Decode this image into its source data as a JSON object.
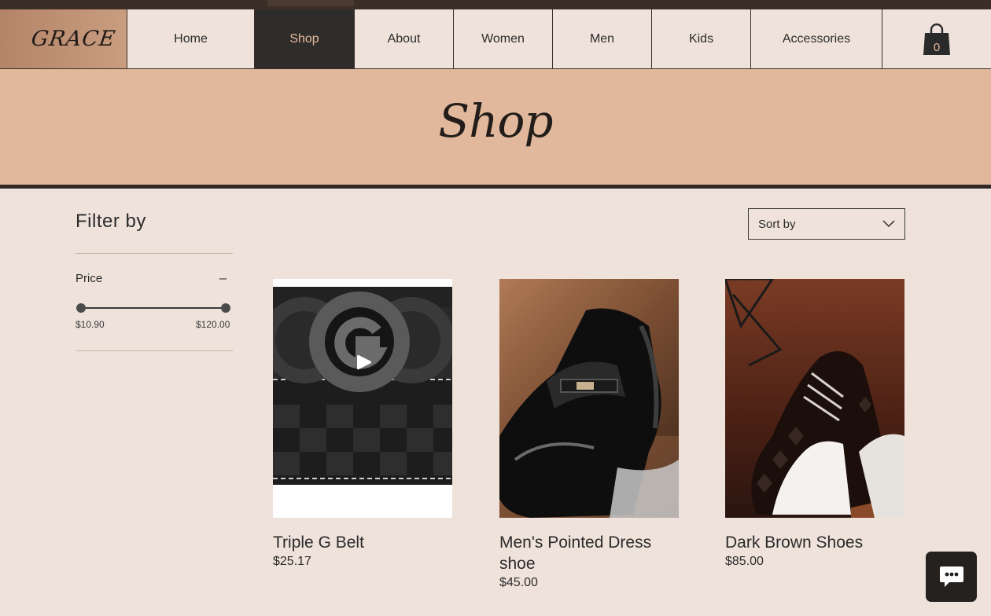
{
  "brand": {
    "logo": "GRACE"
  },
  "nav": {
    "items": [
      {
        "label": "Home"
      },
      {
        "label": "Shop"
      },
      {
        "label": "About"
      },
      {
        "label": "Women"
      },
      {
        "label": "Men"
      },
      {
        "label": "Kids"
      },
      {
        "label": "Accessories"
      }
    ],
    "active": "Shop",
    "cart_count": "0"
  },
  "hero": {
    "title": "Shop"
  },
  "filter": {
    "title": "Filter by",
    "price_label": "Price",
    "collapse_symbol": "–",
    "min_price": "$10.90",
    "max_price": "$120.00"
  },
  "sort": {
    "label": "Sort by"
  },
  "products": [
    {
      "name": "Triple G Belt",
      "price": "$25.17",
      "has_video": true
    },
    {
      "name": "Men's Pointed Dress shoe",
      "price": "$45.00",
      "has_video": false
    },
    {
      "name": "Dark Brown Shoes",
      "price": "$85.00",
      "has_video": false
    }
  ],
  "colors": {
    "background": "#efe2da",
    "hero": "#e1b89b",
    "nav_active": "#2f2d2c",
    "nav_active_text": "#e8b99b",
    "dark": "#2f2825"
  },
  "icons": {
    "cart": "shopping-bag-icon",
    "chat": "chat-bubble-icon",
    "sort": "chevron-down-icon",
    "play": "play-icon"
  }
}
